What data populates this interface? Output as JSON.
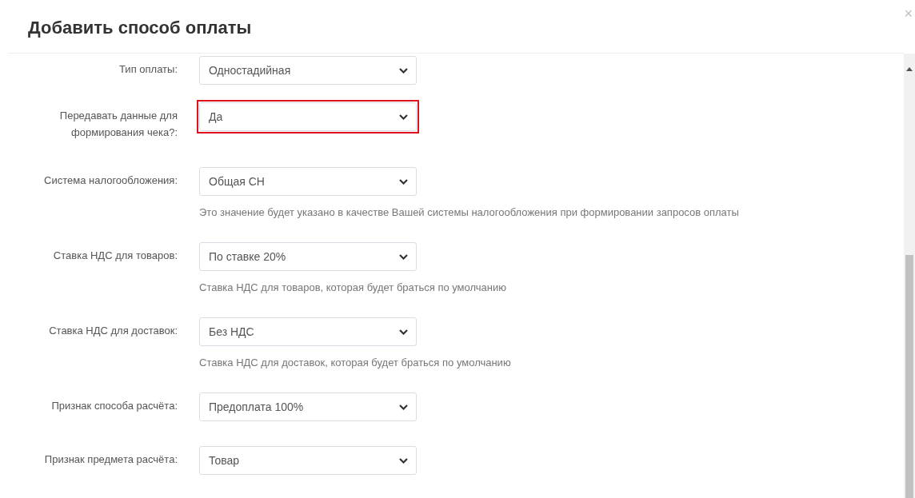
{
  "dialog": {
    "title": "Добавить способ оплаты",
    "close": "×"
  },
  "fields": [
    {
      "label": "Тип оплаты:",
      "value": "Одностадийная",
      "highlighted": false
    },
    {
      "label": "Передавать данные для формирования чека?:",
      "value": "Да",
      "highlighted": true
    },
    {
      "label": "Система налогообложения:",
      "value": "Общая СН",
      "highlighted": false,
      "help": "Это значение будет указано в качестве Вашей системы налогообложения при формировании запросов оплаты"
    },
    {
      "label": "Ставка НДС для товаров:",
      "value": "По ставке 20%",
      "highlighted": false,
      "help": "Ставка НДС для товаров, которая будет браться по умолчанию"
    },
    {
      "label": "Ставка НДС для доставок:",
      "value": "Без НДС",
      "highlighted": false,
      "help": "Ставка НДС для доставок, которая будет браться по умолчанию"
    },
    {
      "label": "Признак способа расчёта:",
      "value": "Предоплата 100%",
      "highlighted": false
    },
    {
      "label": "Признак предмета расчёта:",
      "value": "Товар",
      "highlighted": false
    }
  ]
}
